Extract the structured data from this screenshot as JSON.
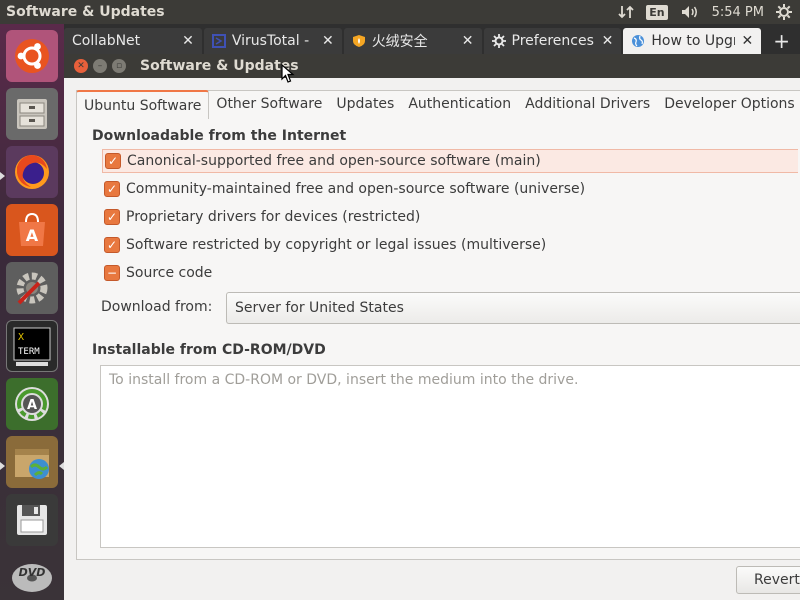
{
  "top_panel": {
    "title": "Software & Updates",
    "keyboard_layout": "En",
    "clock": "5:54 PM"
  },
  "launcher": {
    "items": [
      {
        "icon": "ubuntu-dash-icon"
      },
      {
        "icon": "files-icon"
      },
      {
        "icon": "firefox-icon"
      },
      {
        "icon": "software-center-icon"
      },
      {
        "icon": "system-settings-icon"
      },
      {
        "icon": "xterm-icon",
        "label": "TERM"
      },
      {
        "icon": "software-updater-icon"
      },
      {
        "icon": "archive-icon"
      },
      {
        "icon": "save-disk-icon"
      },
      {
        "icon": "dvd-icon",
        "label": "DVD"
      }
    ]
  },
  "browser_tabs": [
    {
      "label": "CollabNet",
      "favicon": "blank"
    },
    {
      "label": "VirusTotal - ",
      "favicon": "virustotal"
    },
    {
      "label": "火绒安全",
      "favicon": "huorong"
    },
    {
      "label": "Preferences",
      "favicon": "gear"
    },
    {
      "label": "How to Upgrade",
      "favicon": "globe",
      "active": true
    }
  ],
  "window": {
    "title": "Software & Updates"
  },
  "tabs": [
    {
      "label": "Ubuntu Software",
      "active": true
    },
    {
      "label": "Other Software"
    },
    {
      "label": "Updates"
    },
    {
      "label": "Authentication"
    },
    {
      "label": "Additional Drivers"
    },
    {
      "label": "Developer Options"
    }
  ],
  "downloadable": {
    "title": "Downloadable from the Internet",
    "items": [
      {
        "label": "Canonical-supported free and open-source software (main)",
        "state": "checked"
      },
      {
        "label": "Community-maintained free and open-source software (universe)",
        "state": "checked"
      },
      {
        "label": "Proprietary drivers for devices (restricted)",
        "state": "checked"
      },
      {
        "label": "Software restricted by copyright or legal issues (multiverse)",
        "state": "checked"
      },
      {
        "label": "Source code",
        "state": "mixed"
      }
    ],
    "download_from_label": "Download from:",
    "download_from_value": "Server for United States"
  },
  "cdrom": {
    "title": "Installable from CD-ROM/DVD",
    "placeholder": "To install from a CD-ROM or DVD, insert the medium into the drive."
  },
  "buttons": {
    "revert": "Revert"
  },
  "colors": {
    "accent": "#e8783f",
    "panel": "#3c3b37",
    "highlight_row": "#fbe9e3"
  }
}
